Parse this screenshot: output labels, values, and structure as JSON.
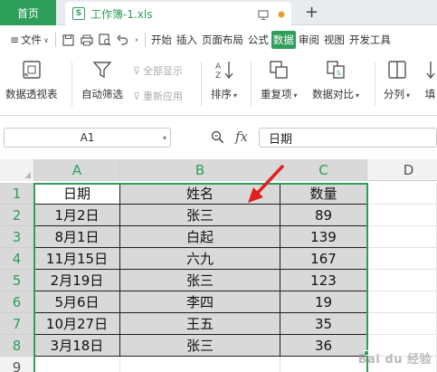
{
  "tabbar": {
    "home_tab": "首页",
    "doc_icon_letter": "S",
    "doc_title": "工作簿-1.xls",
    "new_tab": "+"
  },
  "menubar": {
    "file_menu": "文件",
    "tabs": [
      "开始",
      "插入",
      "页面布局",
      "公式",
      "数据",
      "审阅",
      "视图",
      "开发工具"
    ],
    "active_tab": "数据"
  },
  "ribbon": {
    "pivot_table": "数据透视表",
    "auto_filter": "自动筛选",
    "show_all": "全部显示",
    "reapply": "重新应用",
    "sort": "排序",
    "duplicates": "重复项",
    "data_compare": "数据对比",
    "split_column": "分列",
    "fill": "填"
  },
  "formula_bar": {
    "name_box": "A1",
    "fx_label": "fx",
    "formula_value": "日期"
  },
  "grid": {
    "columns": [
      "A",
      "B",
      "C",
      "D"
    ],
    "rows": [
      "1",
      "2",
      "3",
      "4",
      "5",
      "6",
      "7",
      "8",
      "9"
    ],
    "cells": [
      [
        "日期",
        "姓名",
        "数量"
      ],
      [
        "1月2日",
        "张三",
        "89"
      ],
      [
        "8月1日",
        "白起",
        "139"
      ],
      [
        "11月15日",
        "六九",
        "167"
      ],
      [
        "2月19日",
        "张三",
        "123"
      ],
      [
        "5月6日",
        "李四",
        "19"
      ],
      [
        "10月27日",
        "王五",
        "35"
      ],
      [
        "3月18日",
        "张三",
        "36"
      ]
    ]
  },
  "watermark": "Bai du 经验",
  "colors": {
    "accent": "#2e9e5b",
    "selection_fill": "#d9d9d9",
    "arrow": "#e02020"
  }
}
